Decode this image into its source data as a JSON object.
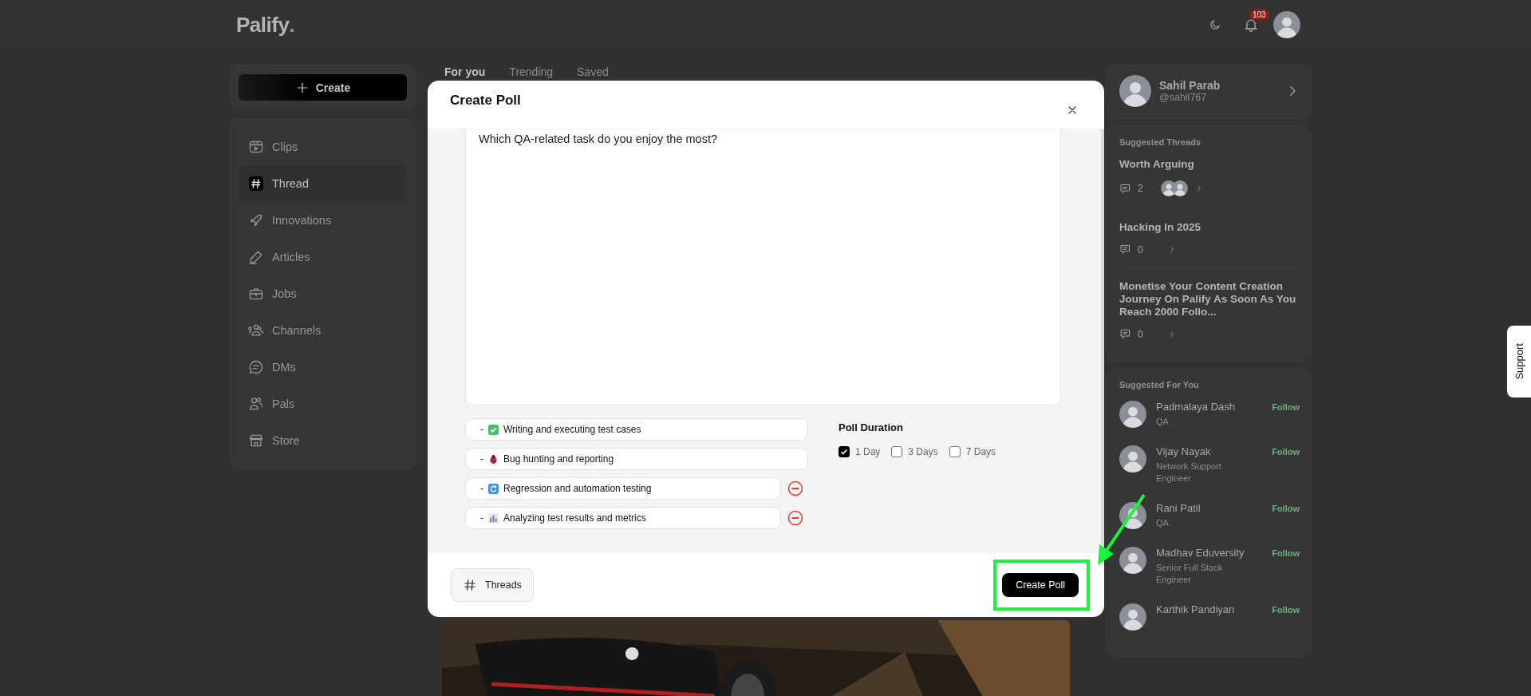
{
  "header": {
    "logo": "Palify",
    "logo_dot": ".",
    "notifications": "103"
  },
  "create_button": "Create",
  "sidebar": {
    "items": [
      {
        "label": "Clips",
        "selected": false
      },
      {
        "label": "Thread",
        "selected": true
      },
      {
        "label": "Innovations",
        "selected": false
      },
      {
        "label": "Articles",
        "selected": false
      },
      {
        "label": "Jobs",
        "selected": false
      },
      {
        "label": "Channels",
        "selected": false
      },
      {
        "label": "DMs",
        "selected": false
      },
      {
        "label": "Pals",
        "selected": false
      },
      {
        "label": "Store",
        "selected": false
      }
    ]
  },
  "feed": {
    "tabs": [
      {
        "label": "For you",
        "selected": true
      },
      {
        "label": "Trending",
        "selected": false
      },
      {
        "label": "Saved",
        "selected": false
      }
    ]
  },
  "profile": {
    "name": "Sahil Parab",
    "handle": "@sahil767"
  },
  "suggested_threads": {
    "title": "Suggested Threads",
    "items": [
      {
        "title": "Worth Arguing",
        "comments": "2"
      },
      {
        "title": "Hacking In 2025",
        "comments": "0"
      },
      {
        "title": "Monetise Your Content Creation Journey On Palify As Soon As You Reach 2000 Follo...",
        "comments": "0"
      }
    ]
  },
  "suggested_for_you": {
    "title": "Suggested For You",
    "people": [
      {
        "name": "Padmalaya Dash",
        "role": "QA",
        "action": "Follow"
      },
      {
        "name": "Vijay Nayak",
        "role": "Network Support Engineer",
        "action": "Follow"
      },
      {
        "name": "Rani Patil",
        "role": "QA",
        "action": "Follow"
      },
      {
        "name": "Madhav Eduversity",
        "role": "Senior Full Stack Engineer",
        "action": "Follow"
      },
      {
        "name": "Karthik Pandiyan",
        "action": "Follow"
      }
    ]
  },
  "support_tab": "Support",
  "modal": {
    "title": "Create Poll",
    "question": "Which QA-related task do you enjoy the most?",
    "options": [
      {
        "text": "Writing and executing test cases",
        "removable": false
      },
      {
        "text": "Bug hunting and reporting",
        "removable": false
      },
      {
        "text": "Regression and automation testing",
        "removable": true
      },
      {
        "text": "Analyzing test results and metrics",
        "removable": true
      }
    ],
    "option_prefix": "-",
    "duration": {
      "title": "Poll Duration",
      "choices": [
        {
          "label": "1 Day",
          "checked": true
        },
        {
          "label": "3 Days",
          "checked": false
        },
        {
          "label": "7 Days",
          "checked": false
        }
      ]
    },
    "threads_button": "Threads",
    "submit_button": "Create Poll"
  }
}
